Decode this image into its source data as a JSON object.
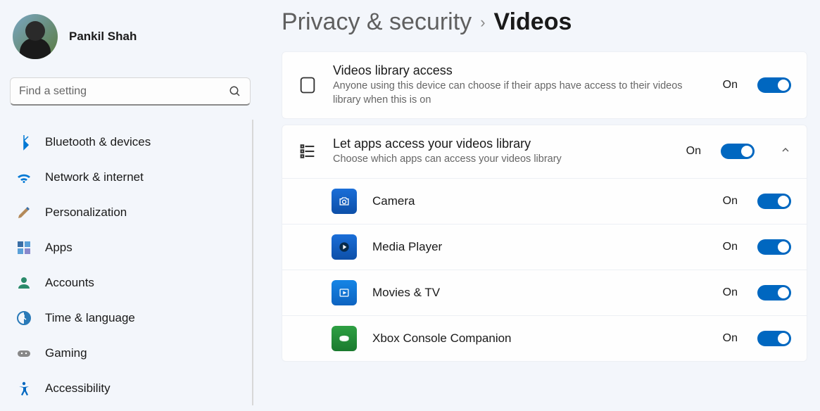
{
  "user": {
    "name": "Pankil Shah"
  },
  "search": {
    "placeholder": "Find a setting"
  },
  "sidebar": {
    "items": [
      {
        "label": "Bluetooth & devices"
      },
      {
        "label": "Network & internet"
      },
      {
        "label": "Personalization"
      },
      {
        "label": "Apps"
      },
      {
        "label": "Accounts"
      },
      {
        "label": "Time & language"
      },
      {
        "label": "Gaming"
      },
      {
        "label": "Accessibility"
      }
    ]
  },
  "breadcrumb": {
    "parent": "Privacy & security",
    "current": "Videos"
  },
  "settings": {
    "library": {
      "title": "Videos library access",
      "desc": "Anyone using this device can choose if their apps have access to their videos library when this is on",
      "state": "On"
    },
    "apps_header": {
      "title": "Let apps access your videos library",
      "desc": "Choose which apps can access your videos library",
      "state": "On"
    },
    "apps": [
      {
        "name": "Camera",
        "state": "On"
      },
      {
        "name": "Media Player",
        "state": "On"
      },
      {
        "name": "Movies & TV",
        "state": "On"
      },
      {
        "name": "Xbox Console Companion",
        "state": "On"
      }
    ]
  }
}
